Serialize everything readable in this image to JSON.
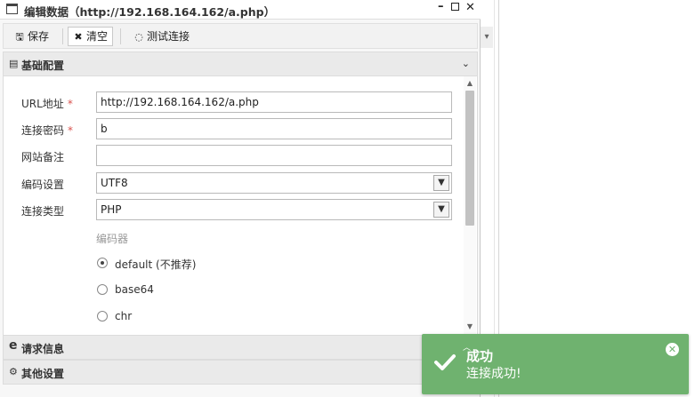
{
  "window": {
    "title": "编辑数据（http://192.168.164.162/a.php）"
  },
  "toolbar": {
    "save_label": "保存",
    "clear_label": "清空",
    "test_label": "测试连接"
  },
  "sections": {
    "basic": "基础配置",
    "request": "请求信息",
    "other": "其他设置"
  },
  "form": {
    "url_label": "URL地址",
    "url_value": "http://192.168.164.162/a.php",
    "password_label": "连接密码",
    "password_value": "b",
    "note_label": "网站备注",
    "note_value": "",
    "encoding_label": "编码设置",
    "encoding_value": "UTF8",
    "type_label": "连接类型",
    "type_value": "PHP",
    "required_mark": "*",
    "encoder_title": "编码器",
    "encoders": [
      {
        "label": "default (不推荐)",
        "checked": true
      },
      {
        "label": "base64",
        "checked": false
      },
      {
        "label": "chr",
        "checked": false
      }
    ]
  },
  "toast": {
    "title": "成功",
    "message": "连接成功!",
    "color": "#6fb26f"
  }
}
